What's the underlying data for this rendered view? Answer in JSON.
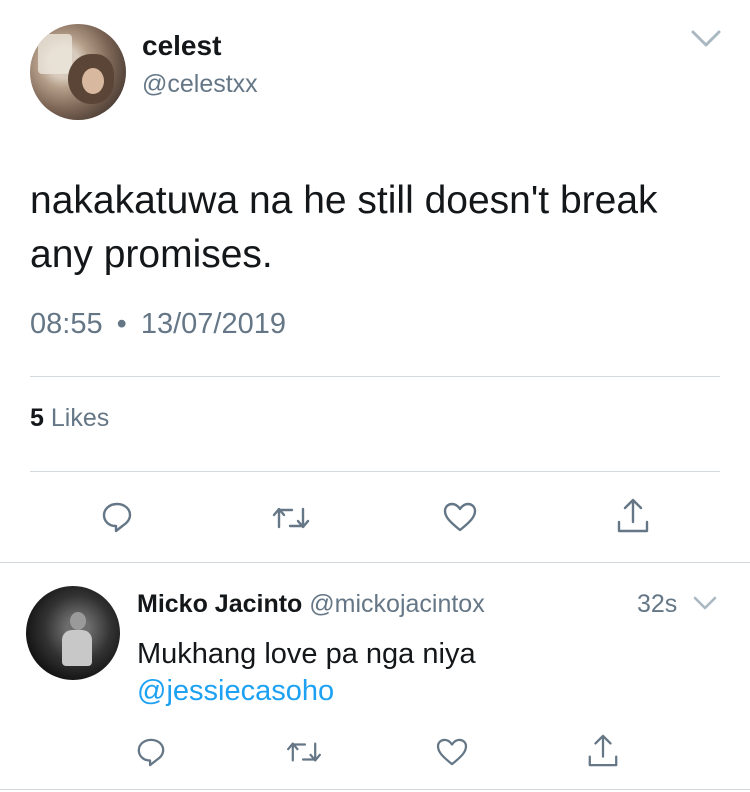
{
  "tweet": {
    "display_name": "celest",
    "handle": "@celestxx",
    "text_line1": "nakakatuwa na he still doesn't break",
    "text_line2": "any promises.",
    "time": "08:55",
    "separator": "•",
    "date": "13/07/2019",
    "likes_count": "5",
    "likes_label": "Likes"
  },
  "reply": {
    "display_name": "Micko Jacinto",
    "handle": "@mickojacintox",
    "age": "32s",
    "text": "Mukhang love pa nga niya",
    "mention": "@jessiecasoho"
  },
  "colors": {
    "text": "#14171a",
    "secondary": "#657786",
    "link": "#1da1f2",
    "divider": "#d3d8dc"
  },
  "icons": [
    "chevron-down-icon",
    "reply-icon",
    "retweet-icon",
    "heart-icon",
    "share-icon"
  ]
}
